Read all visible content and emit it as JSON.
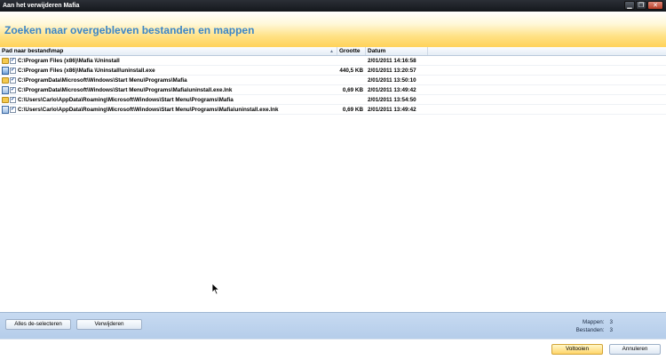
{
  "window": {
    "title": "Aan het verwijderen Mafia",
    "minimize": "▁",
    "maximize": "❐",
    "close": "✕"
  },
  "header": {
    "heading": "Zoeken naar overgebleven bestanden en mappen"
  },
  "table": {
    "columns": {
      "path": "Pad naar bestand\\map",
      "size": "Grootte",
      "date": "Datum",
      "sort_indicator": "▲"
    },
    "rows": [
      {
        "icon": "folder-icon",
        "checked": "✓",
        "path": "C:\\Program Files (x86)\\Mafia \\Uninstall",
        "size": "",
        "date": "2/01/2011 14:16:58"
      },
      {
        "icon": "exe-icon",
        "checked": "✓",
        "path": "C:\\Program Files (x86)\\Mafia \\Uninstall\\uninstall.exe",
        "size": "440,5 KB",
        "date": "2/01/2011 13:20:57"
      },
      {
        "icon": "folder-icon",
        "checked": "✓",
        "path": "C:\\ProgramData\\Microsoft\\Windows\\Start Menu\\Programs\\Mafia",
        "size": "",
        "date": "2/01/2011 13:50:10"
      },
      {
        "icon": "shortcut-icon",
        "checked": "✓",
        "path": "C:\\ProgramData\\Microsoft\\Windows\\Start Menu\\Programs\\Mafia\\uninstall.exe.lnk",
        "size": "0,69 KB",
        "date": "2/01/2011 13:49:42"
      },
      {
        "icon": "folder-icon",
        "checked": "✓",
        "path": "C:\\Users\\Carlo\\AppData\\Roaming\\Microsoft\\Windows\\Start Menu\\Programs\\Mafia",
        "size": "",
        "date": "2/01/2011 13:54:50"
      },
      {
        "icon": "shortcut-icon",
        "checked": "✓",
        "path": "C:\\Users\\Carlo\\AppData\\Roaming\\Microsoft\\Windows\\Start Menu\\Programs\\Mafia\\uninstall.exe.lnk",
        "size": "0,69 KB",
        "date": "2/01/2011 13:49:42"
      }
    ]
  },
  "actions": {
    "deselect_all": "Alles de-selecteren",
    "remove": "Verwijderen"
  },
  "stats": {
    "folders_label": "Mappen:",
    "folders_value": "3",
    "files_label": "Bestanden:",
    "files_value": "3"
  },
  "footer": {
    "finish": "Voltooien",
    "cancel": "Annuleren"
  },
  "colors": {
    "heading": "#3d86c6",
    "banner_bottom": "#ffd25a",
    "panel": "#c7daf1"
  }
}
